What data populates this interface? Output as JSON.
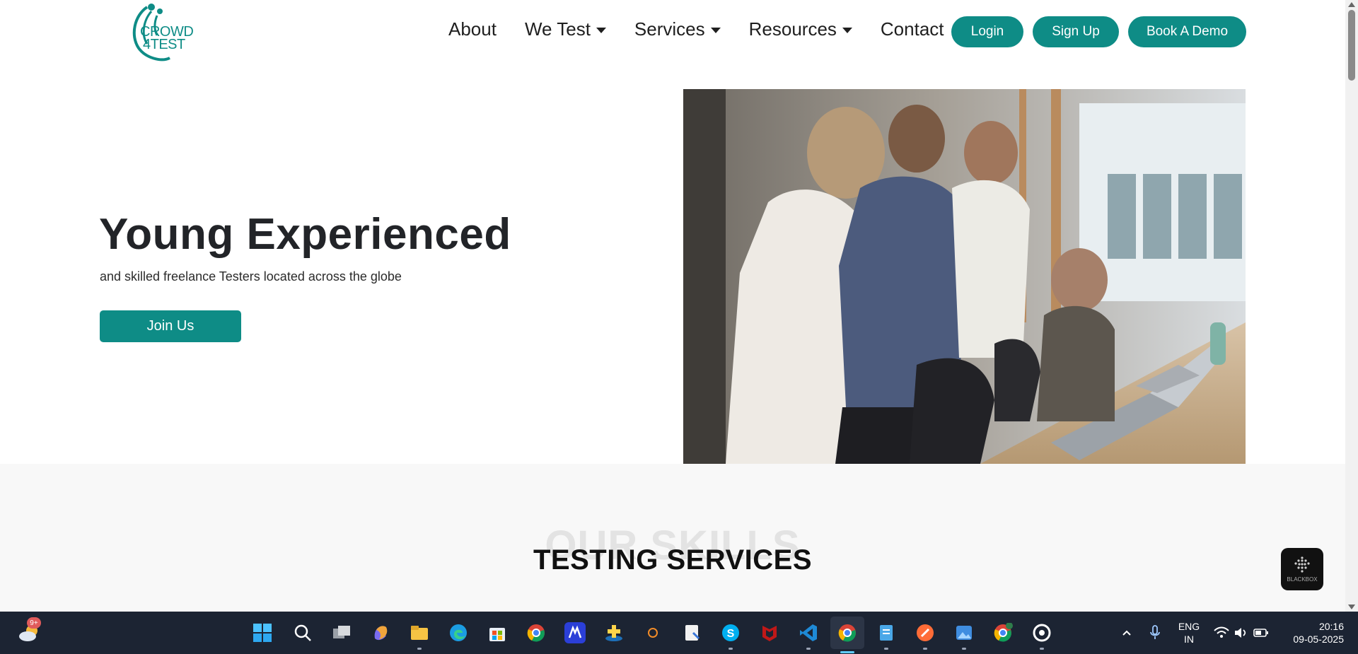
{
  "header": {
    "logo": {
      "line1": "CROWD",
      "line2": "4TEST"
    },
    "nav": [
      {
        "label": "About",
        "dropdown": false
      },
      {
        "label": "We Test",
        "dropdown": true
      },
      {
        "label": "Services",
        "dropdown": true
      },
      {
        "label": "Resources",
        "dropdown": true
      },
      {
        "label": "Contact",
        "dropdown": false
      }
    ],
    "buttons": {
      "login": "Login",
      "signup": "Sign Up",
      "demo": "Book A Demo"
    }
  },
  "hero": {
    "title": "Young Experienced",
    "subtitle": "and skilled freelance Testers located across the globe",
    "cta": "Join Us",
    "image": "team-working-at-laptop-photo"
  },
  "skills": {
    "ghost_title": "OUR SKILLS",
    "title": "TESTING SERVICES"
  },
  "widget": {
    "label": "BLACKBOX"
  },
  "colors": {
    "brand": "#0e8c86",
    "text": "#222428",
    "section_bg": "#f8f8f8",
    "taskbar": "#1c2433"
  },
  "taskbar": {
    "weather_badge": "9+",
    "apps": [
      "start-icon",
      "search-icon",
      "task-view-icon",
      "copilot-icon",
      "file-explorer-icon",
      "edge-icon",
      "store-icon",
      "chrome-icon",
      "app-m-icon",
      "app-plus-icon",
      "app-o-icon",
      "notepad-icon",
      "skype-icon",
      "mcafee-icon",
      "vscode-icon",
      "chrome-active-icon",
      "notepad-blue-icon",
      "postman-icon",
      "photos-icon",
      "chrome-s-icon",
      "app-circle-icon"
    ],
    "tray": {
      "lang_line1": "ENG",
      "lang_line2": "IN",
      "time": "20:16",
      "date": "09-05-2025"
    }
  }
}
